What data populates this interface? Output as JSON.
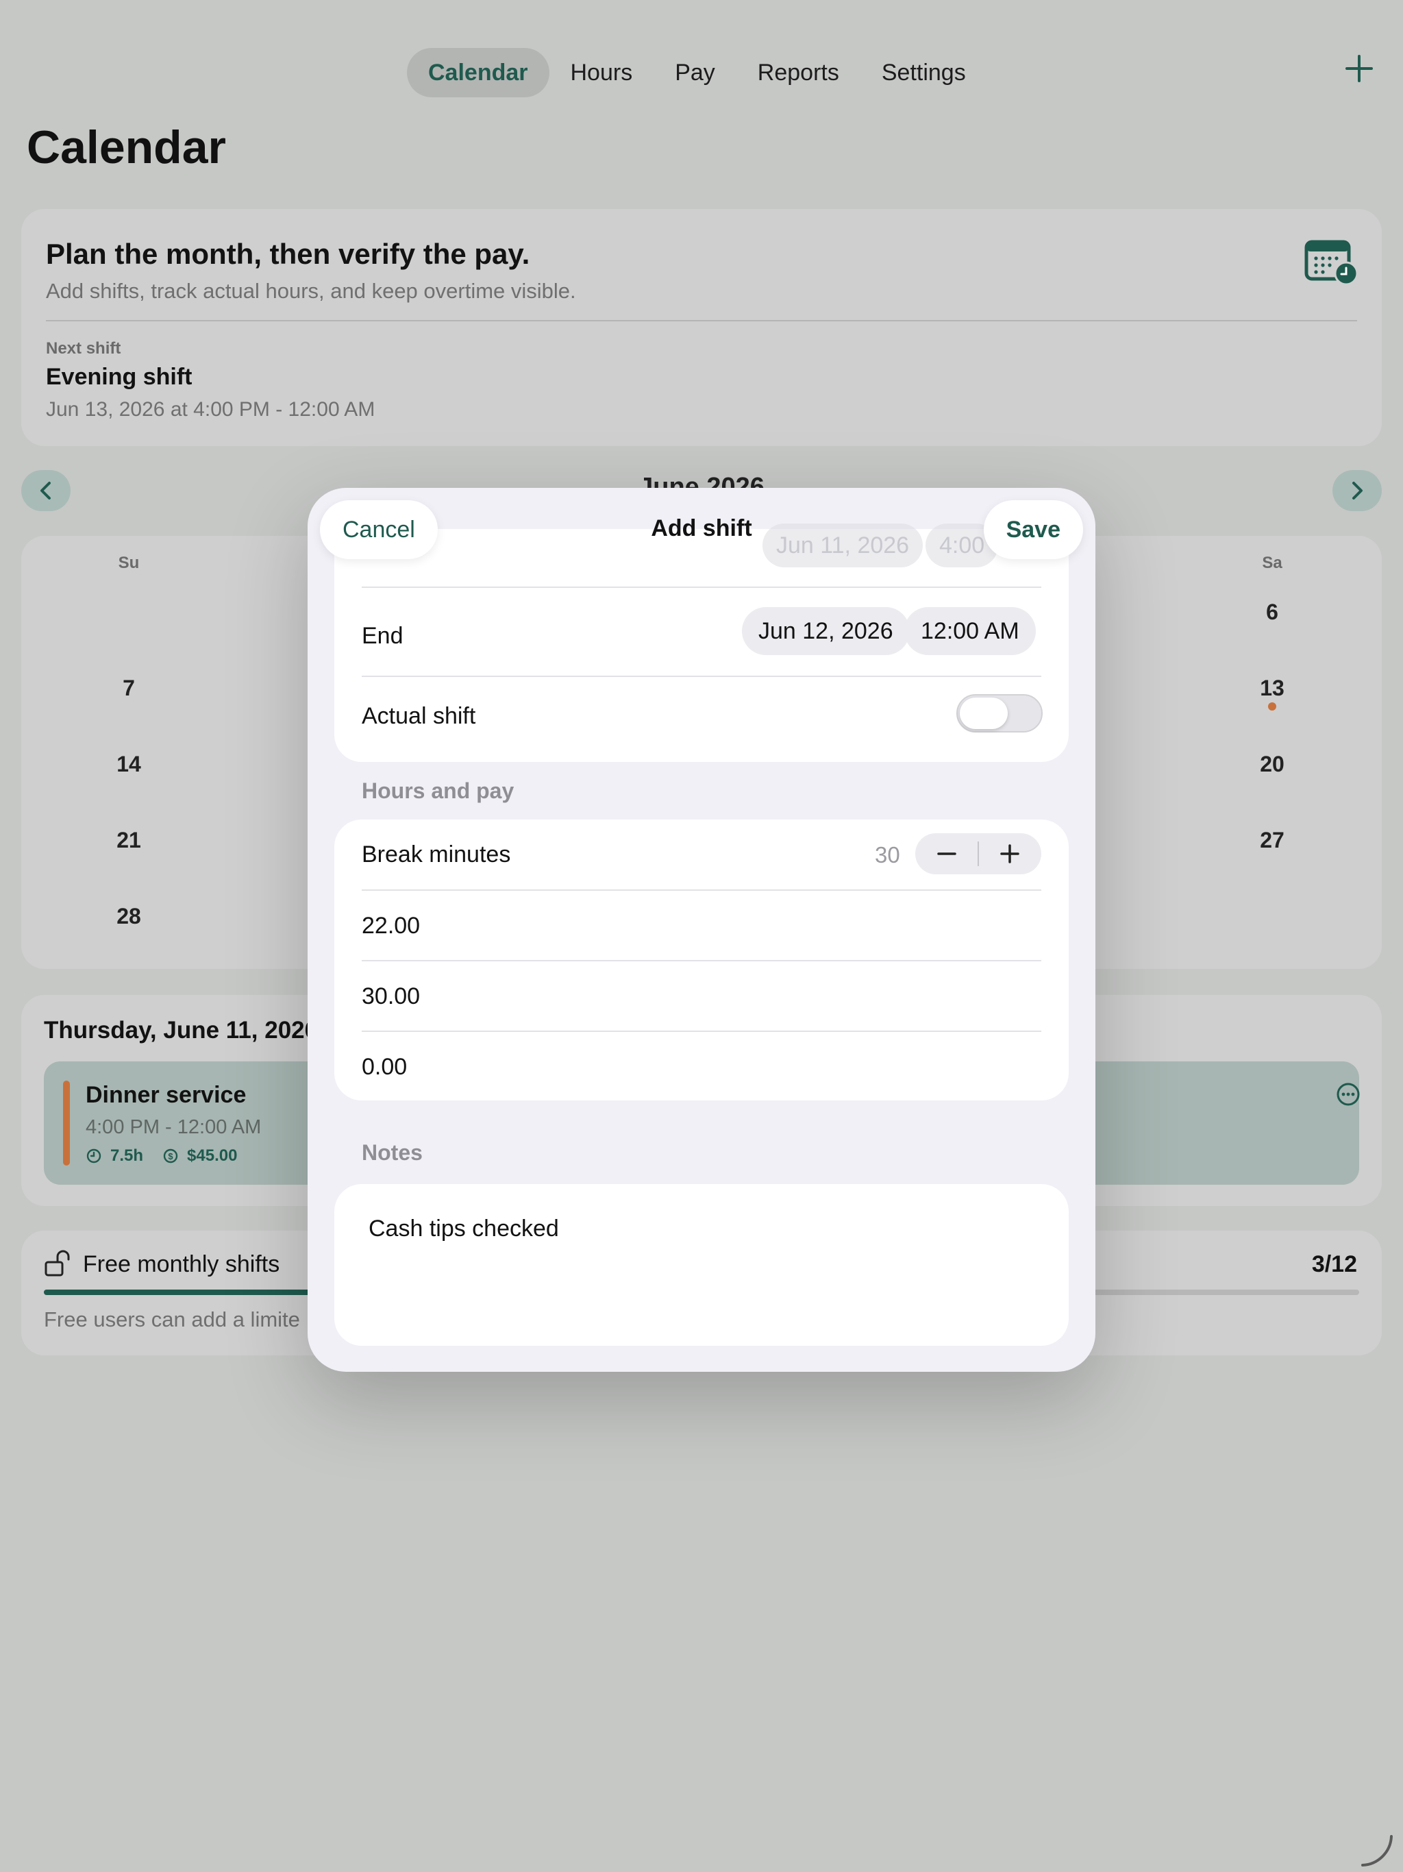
{
  "tabs": [
    {
      "label": "Calendar",
      "active": true
    },
    {
      "label": "Hours",
      "active": false
    },
    {
      "label": "Pay",
      "active": false
    },
    {
      "label": "Reports",
      "active": false
    },
    {
      "label": "Settings",
      "active": false
    }
  ],
  "page_title": "Calendar",
  "hero": {
    "title": "Plan the month, then verify the pay.",
    "subtitle": "Add shifts, track actual hours, and keep overtime visible.",
    "next_label": "Next shift",
    "next_name": "Evening shift",
    "next_time": "Jun 13, 2026 at 4:00 PM - 12:00 AM",
    "icon": "calendar-clock-icon"
  },
  "calendar": {
    "month": "June 2026",
    "weekday_labels": {
      "su": "Su",
      "sa": "Sa"
    },
    "sunday_days": [
      "7",
      "14",
      "21",
      "28"
    ],
    "saturday_days": [
      "6",
      "13",
      "20",
      "27"
    ],
    "event_day": "13"
  },
  "day_detail": {
    "title": "Thursday, June 11, 2026",
    "shift_name": "Dinner service",
    "shift_time": "4:00 PM - 12:00 AM",
    "hours": "7.5h",
    "pay": "$45.00"
  },
  "free_plan": {
    "title": "Free monthly shifts",
    "count": "3/12",
    "used": 3,
    "limit": 12,
    "description": "Free users can add a limite"
  },
  "modal": {
    "title": "Add shift",
    "cancel_label": "Cancel",
    "save_label": "Save",
    "start_date_ghost": "Jun 11, 2026",
    "start_time_ghost": "4:00",
    "end_label": "End",
    "end_date": "Jun 12, 2026",
    "end_time": "12:00 AM",
    "actual_shift_label": "Actual shift",
    "actual_shift_on": false,
    "hours_pay_header": "Hours and pay",
    "break_label": "Break minutes",
    "break_value": "30",
    "field_1": "22.00",
    "field_2": "30.00",
    "field_3": "0.00",
    "notes_header": "Notes",
    "notes_text": "Cash tips checked"
  },
  "colors": {
    "accent": "#1f5a4e",
    "event": "#c9713b",
    "backdrop": "#c6c8c6",
    "sheet": "#f1f0f6"
  }
}
